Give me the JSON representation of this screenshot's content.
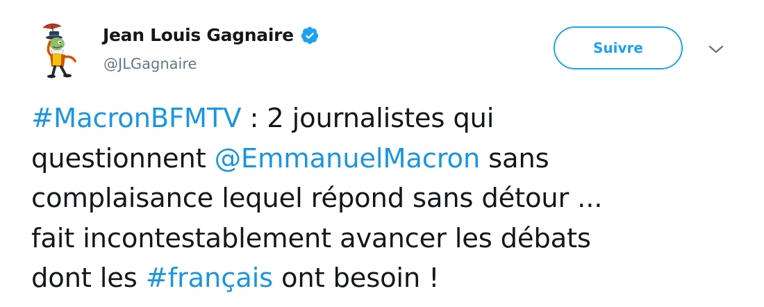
{
  "author": {
    "display_name": "Jean Louis Gagnaire",
    "handle": "@JLGagnaire",
    "verified": true,
    "avatar_icon": "jiminy-cricket-avatar-icon",
    "verified_icon": "verified-badge-icon"
  },
  "actions": {
    "follow_label": "Suivre",
    "menu_icon": "chevron-down-icon"
  },
  "tweet": {
    "lines": [
      [
        {
          "text": "#MacronBFMTV",
          "type": "hashtag"
        },
        {
          "text": " : 2 journalistes qui",
          "type": "text"
        }
      ],
      [
        {
          "text": "questionnent ",
          "type": "text"
        },
        {
          "text": "@EmmanuelMacron",
          "type": "mention"
        },
        {
          "text": " sans",
          "type": "text"
        }
      ],
      [
        {
          "text": "complaisance lequel répond sans détour ...",
          "type": "text"
        }
      ],
      [
        {
          "text": "fait incontestablement avancer les débats",
          "type": "text"
        }
      ],
      [
        {
          "text": "dont les ",
          "type": "text"
        },
        {
          "text": "#français",
          "type": "hashtag"
        },
        {
          "text": " ont besoin !",
          "type": "text"
        }
      ]
    ]
  },
  "colors": {
    "accent": "#1da1f2",
    "link": "#1b95e0",
    "text": "#14171a",
    "secondary_text": "#657786"
  }
}
